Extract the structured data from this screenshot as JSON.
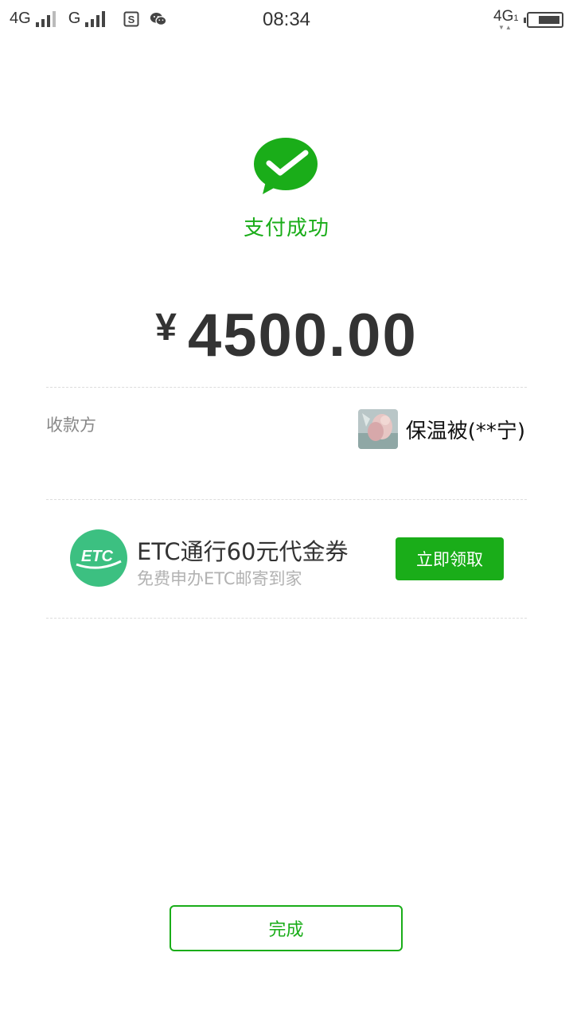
{
  "status_bar": {
    "sim1_network": "4G",
    "sim2_network": "G",
    "time": "08:34",
    "data_network": "4G",
    "data_sub": "1",
    "notification_icons": [
      "s-app-icon",
      "wechat-icon"
    ]
  },
  "payment": {
    "status_text": "支付成功",
    "currency_symbol": "¥",
    "amount": "4500.00"
  },
  "payee": {
    "label": "收款方",
    "name": "保温被(**宁)"
  },
  "promo": {
    "logo_text": "ETC",
    "title": "ETC通行60元代金券",
    "subtitle": "免费申办ETC邮寄到家",
    "button_label": "立即领取"
  },
  "actions": {
    "done_label": "完成"
  },
  "colors": {
    "accent": "#1aad19",
    "etc_green": "#3cc081"
  }
}
